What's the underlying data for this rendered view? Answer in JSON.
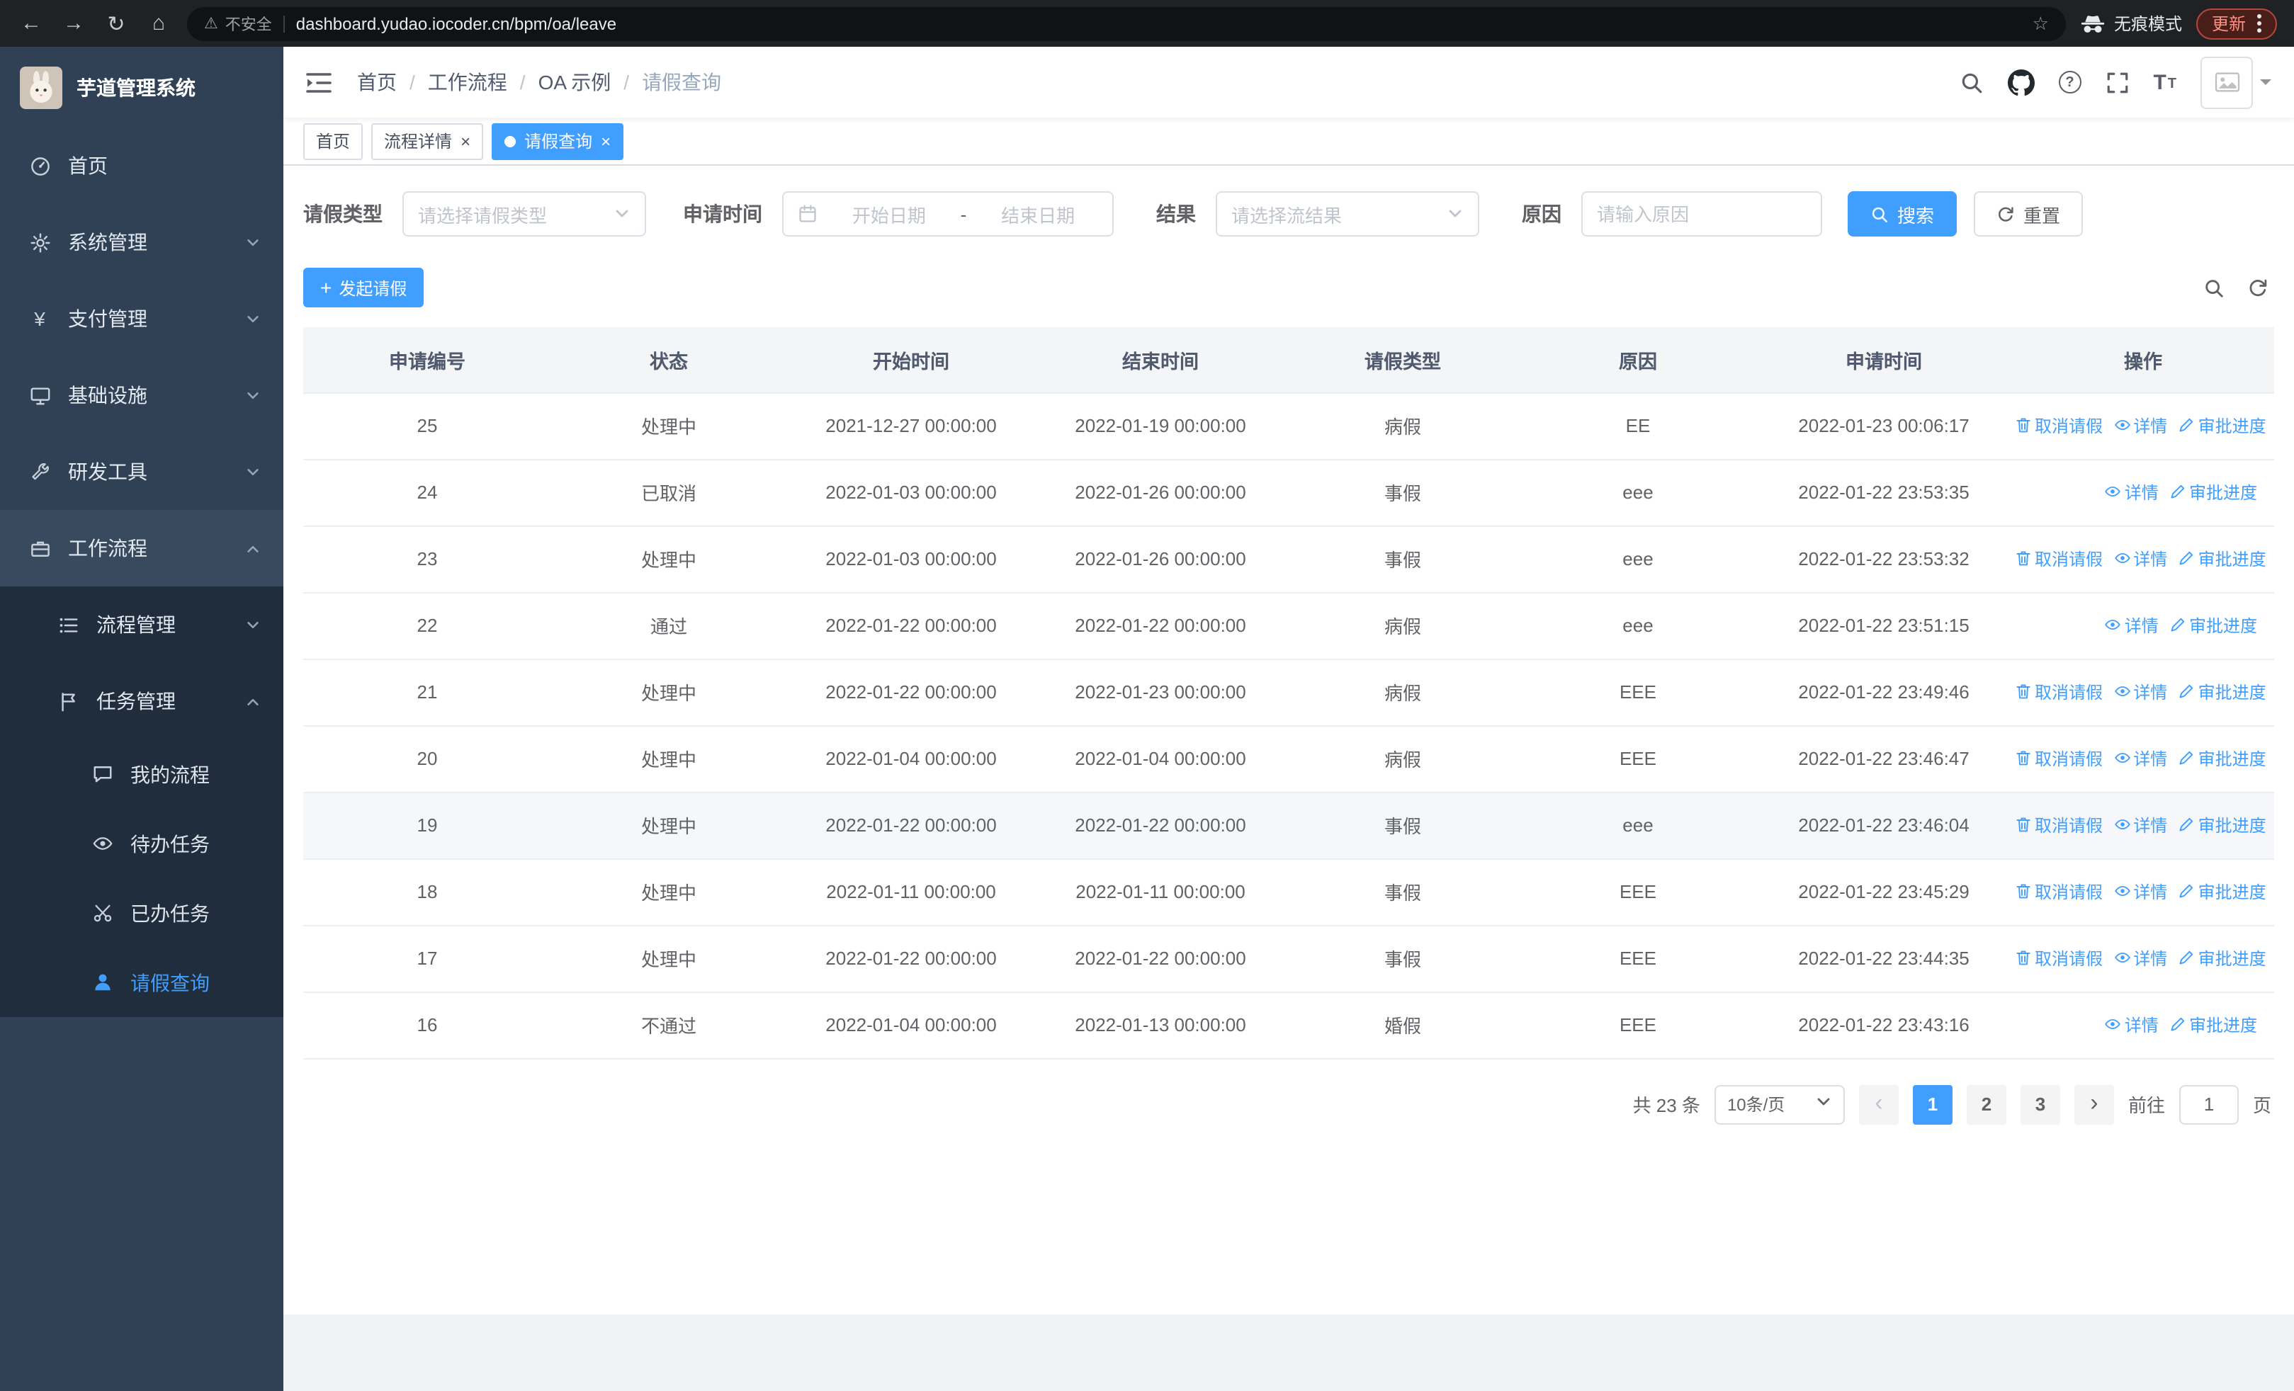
{
  "glyphs": {
    "back": "←",
    "forward": "→",
    "reload": "↻",
    "home": "⌂",
    "star": "☆",
    "warning": "⚠",
    "close": "×",
    "yen": "¥",
    "help": "?",
    "font_large": "T",
    "font_small": "T",
    "plus": "+",
    "prev": "‹",
    "next": "›",
    "date_sep": "-",
    "sep": "/"
  },
  "browser": {
    "security_warning": "不安全",
    "url": "dashboard.yudao.iocoder.cn/bpm/oa/leave",
    "incognito_label": "无痕模式",
    "update_label": "更新"
  },
  "sidebar": {
    "logo_title": "芋道管理系统",
    "items": [
      "首页",
      "系统管理",
      "支付管理",
      "基础设施",
      "研发工具",
      "工作流程"
    ],
    "submenu": [
      "流程管理",
      "任务管理"
    ],
    "task_children": [
      "我的流程",
      "待办任务",
      "已办任务",
      "请假查询"
    ]
  },
  "header": {
    "breadcrumb": [
      "首页",
      "工作流程",
      "OA 示例",
      "请假查询"
    ]
  },
  "tabs": [
    {
      "label": "首页"
    },
    {
      "label": "流程详情"
    },
    {
      "label": "请假查询"
    }
  ],
  "filters": {
    "leave_type_label": "请假类型",
    "leave_type_placeholder": "请选择请假类型",
    "apply_time_label": "申请时间",
    "start_date_placeholder": "开始日期",
    "end_date_placeholder": "结束日期",
    "result_label": "结果",
    "result_placeholder": "请选择流结果",
    "reason_label": "原因",
    "reason_placeholder": "请输入原因",
    "search_label": "搜索",
    "reset_label": "重置"
  },
  "toolbar": {
    "create_label": "发起请假"
  },
  "table": {
    "columns": [
      "申请编号",
      "状态",
      "开始时间",
      "结束时间",
      "请假类型",
      "原因",
      "申请时间",
      "操作"
    ],
    "actions": {
      "cancel": "取消请假",
      "detail": "详情",
      "progress": "审批进度"
    },
    "rows": [
      {
        "id": "25",
        "status": "处理中",
        "start": "2021-12-27 00:00:00",
        "end": "2022-01-19 00:00:00",
        "type": "病假",
        "reason": "EE",
        "applied": "2022-01-23 00:06:17",
        "can_cancel": true
      },
      {
        "id": "24",
        "status": "已取消",
        "start": "2022-01-03 00:00:00",
        "end": "2022-01-26 00:00:00",
        "type": "事假",
        "reason": "eee",
        "applied": "2022-01-22 23:53:35",
        "can_cancel": false
      },
      {
        "id": "23",
        "status": "处理中",
        "start": "2022-01-03 00:00:00",
        "end": "2022-01-26 00:00:00",
        "type": "事假",
        "reason": "eee",
        "applied": "2022-01-22 23:53:32",
        "can_cancel": true
      },
      {
        "id": "22",
        "status": "通过",
        "start": "2022-01-22 00:00:00",
        "end": "2022-01-22 00:00:00",
        "type": "病假",
        "reason": "eee",
        "applied": "2022-01-22 23:51:15",
        "can_cancel": false
      },
      {
        "id": "21",
        "status": "处理中",
        "start": "2022-01-22 00:00:00",
        "end": "2022-01-23 00:00:00",
        "type": "病假",
        "reason": "EEE",
        "applied": "2022-01-22 23:49:46",
        "can_cancel": true
      },
      {
        "id": "20",
        "status": "处理中",
        "start": "2022-01-04 00:00:00",
        "end": "2022-01-04 00:00:00",
        "type": "病假",
        "reason": "EEE",
        "applied": "2022-01-22 23:46:47",
        "can_cancel": true
      },
      {
        "id": "19",
        "status": "处理中",
        "start": "2022-01-22 00:00:00",
        "end": "2022-01-22 00:00:00",
        "type": "事假",
        "reason": "eee",
        "applied": "2022-01-22 23:46:04",
        "can_cancel": true,
        "highlighted": true
      },
      {
        "id": "18",
        "status": "处理中",
        "start": "2022-01-11 00:00:00",
        "end": "2022-01-11 00:00:00",
        "type": "事假",
        "reason": "EEE",
        "applied": "2022-01-22 23:45:29",
        "can_cancel": true
      },
      {
        "id": "17",
        "status": "处理中",
        "start": "2022-01-22 00:00:00",
        "end": "2022-01-22 00:00:00",
        "type": "事假",
        "reason": "EEE",
        "applied": "2022-01-22 23:44:35",
        "can_cancel": true
      },
      {
        "id": "16",
        "status": "不通过",
        "start": "2022-01-04 00:00:00",
        "end": "2022-01-13 00:00:00",
        "type": "婚假",
        "reason": "EEE",
        "applied": "2022-01-22 23:43:16",
        "can_cancel": false
      }
    ]
  },
  "pagination": {
    "total_text": "共 23 条",
    "page_size": "10条/页",
    "pages": [
      "1",
      "2",
      "3"
    ],
    "goto_label": "前往",
    "goto_value": "1",
    "page_unit": "页"
  }
}
